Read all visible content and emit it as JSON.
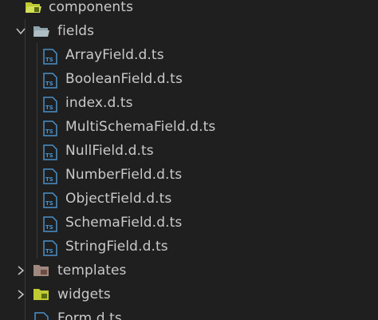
{
  "tree": {
    "components": {
      "label": "components",
      "icon": "folder-open-icon",
      "color": "#c0ca33"
    },
    "fields": {
      "label": "fields",
      "icon": "folder-open-icon",
      "color": "#90a4ae"
    },
    "files": [
      {
        "label": "ArrayField.d.ts",
        "icon": "typescript-file-icon"
      },
      {
        "label": "BooleanField.d.ts",
        "icon": "typescript-file-icon"
      },
      {
        "label": "index.d.ts",
        "icon": "typescript-file-icon"
      },
      {
        "label": "MultiSchemaField.d.ts",
        "icon": "typescript-file-icon"
      },
      {
        "label": "NullField.d.ts",
        "icon": "typescript-file-icon"
      },
      {
        "label": "NumberField.d.ts",
        "icon": "typescript-file-icon"
      },
      {
        "label": "ObjectField.d.ts",
        "icon": "typescript-file-icon"
      },
      {
        "label": "SchemaField.d.ts",
        "icon": "typescript-file-icon"
      },
      {
        "label": "StringField.d.ts",
        "icon": "typescript-file-icon"
      }
    ],
    "templates": {
      "label": "templates",
      "icon": "folder-icon",
      "color": "#a1887f"
    },
    "widgets": {
      "label": "widgets",
      "icon": "folder-icon",
      "color": "#c0ca33"
    },
    "form": {
      "label": "Form.d.ts",
      "icon": "typescript-file-icon"
    },
    "ts_icon_color": "#4a90c8"
  }
}
